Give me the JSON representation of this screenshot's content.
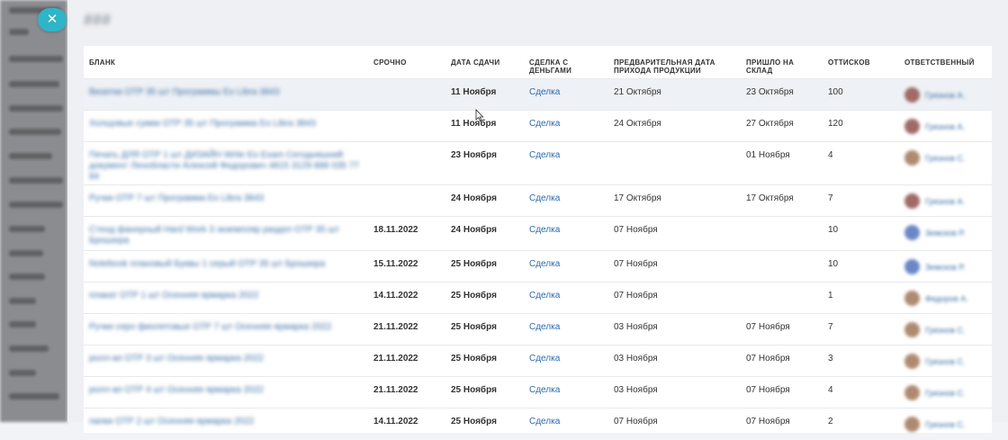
{
  "close_symbol": "✕",
  "modal_title": "###",
  "columns": {
    "blank": "Бланк",
    "urgent": "Срочно",
    "due": "Дата сдачи",
    "deal": "Сделка с деньгами",
    "pre_date": "Предварительная дата прихода продукции",
    "arrived": "Пришло на склад",
    "prints": "Оттисков",
    "responsible": "Ответственный"
  },
  "rows": [
    {
      "blank": "Визитки ОТР 35 шт Программы Eo Libra 3843",
      "urgent": "",
      "due": "11 Ноября",
      "deal": "Сделка",
      "pre_date": "21 Октября",
      "arrived": "23 Октября",
      "prints": "100",
      "responsible": "Грязнов А.",
      "avatar": "red"
    },
    {
      "blank": "Холщовые сумки ОТР 35 шт Программа Eo Libra 3843",
      "urgent": "",
      "due": "11 Ноября",
      "deal": "Сделка",
      "pre_date": "24 Октября",
      "arrived": "27 Октября",
      "prints": "120",
      "responsible": "Грязнов А.",
      "avatar": "red"
    },
    {
      "blank": "Печать ДЛЯ ОТР 1 шт ДИЗАЙН Write Eo Exam Сегодняшний документ Ленобласти Алексей Федорович 4815 3129 888 035 77 84",
      "urgent": "",
      "due": "23 Ноября",
      "deal": "Сделка",
      "pre_date": "",
      "arrived": "01 Ноября",
      "prints": "4",
      "responsible": "Грязнов С.",
      "avatar": "tan"
    },
    {
      "blank": "Ручки ОТР 7 шт Программа Eo Libra 3843",
      "urgent": "",
      "due": "24 Ноября",
      "deal": "Сделка",
      "pre_date": "17 Октября",
      "arrived": "17 Октября",
      "prints": "7",
      "responsible": "Грязнов А.",
      "avatar": "red"
    },
    {
      "blank": "Стенд фанерный Hard Work 3 экземпляр раздел ОТР 35 шт Брошюра",
      "urgent": "18.11.2022",
      "due": "24 Ноября",
      "deal": "Сделка",
      "pre_date": "07 Ноября",
      "arrived": "",
      "prints": "10",
      "responsible": "Земсков Р.",
      "avatar": "blue"
    },
    {
      "blank": "Notebook плановый Буквы 1 серый ОТР 35 шт Брошюра",
      "urgent": "15.11.2022",
      "due": "25 Ноября",
      "deal": "Сделка",
      "pre_date": "07 Ноября",
      "arrived": "",
      "prints": "10",
      "responsible": "Земсков Р.",
      "avatar": "blue"
    },
    {
      "blank": "плакат ОТР 1 шт Осенняя ярмарка 2022",
      "urgent": "14.11.2022",
      "due": "25 Ноября",
      "deal": "Сделка",
      "pre_date": "07 Ноября",
      "arrived": "",
      "prints": "1",
      "responsible": "Федоров А.",
      "avatar": "tan"
    },
    {
      "blank": "Ручки серо фиолетовые ОТР 7 шт Осенняя ярмарка 2022",
      "urgent": "21.11.2022",
      "due": "25 Ноября",
      "deal": "Сделка",
      "pre_date": "03 Ноября",
      "arrived": "07 Ноября",
      "prints": "7",
      "responsible": "Грязнов С.",
      "avatar": "tan"
    },
    {
      "blank": "ролл-ап ОТР 3 шт Осенняя ярмарка 2022",
      "urgent": "21.11.2022",
      "due": "25 Ноября",
      "deal": "Сделка",
      "pre_date": "03 Ноября",
      "arrived": "07 Ноября",
      "prints": "3",
      "responsible": "Грязнов С.",
      "avatar": "tan"
    },
    {
      "blank": "ролл-ап ОТР 4 шт Осенняя ярмарка 2022",
      "urgent": "21.11.2022",
      "due": "25 Ноября",
      "deal": "Сделка",
      "pre_date": "03 Ноября",
      "arrived": "07 Ноября",
      "prints": "4",
      "responsible": "Грязнов С.",
      "avatar": "tan"
    },
    {
      "blank": "папки ОТР 2 шт Осенняя ярмарка 2022",
      "urgent": "14.11.2022",
      "due": "25 Ноября",
      "deal": "Сделка",
      "pre_date": "07 Ноября",
      "arrived": "07 Ноября",
      "prints": "2",
      "responsible": "Грязнов С.",
      "avatar": "tan"
    }
  ]
}
